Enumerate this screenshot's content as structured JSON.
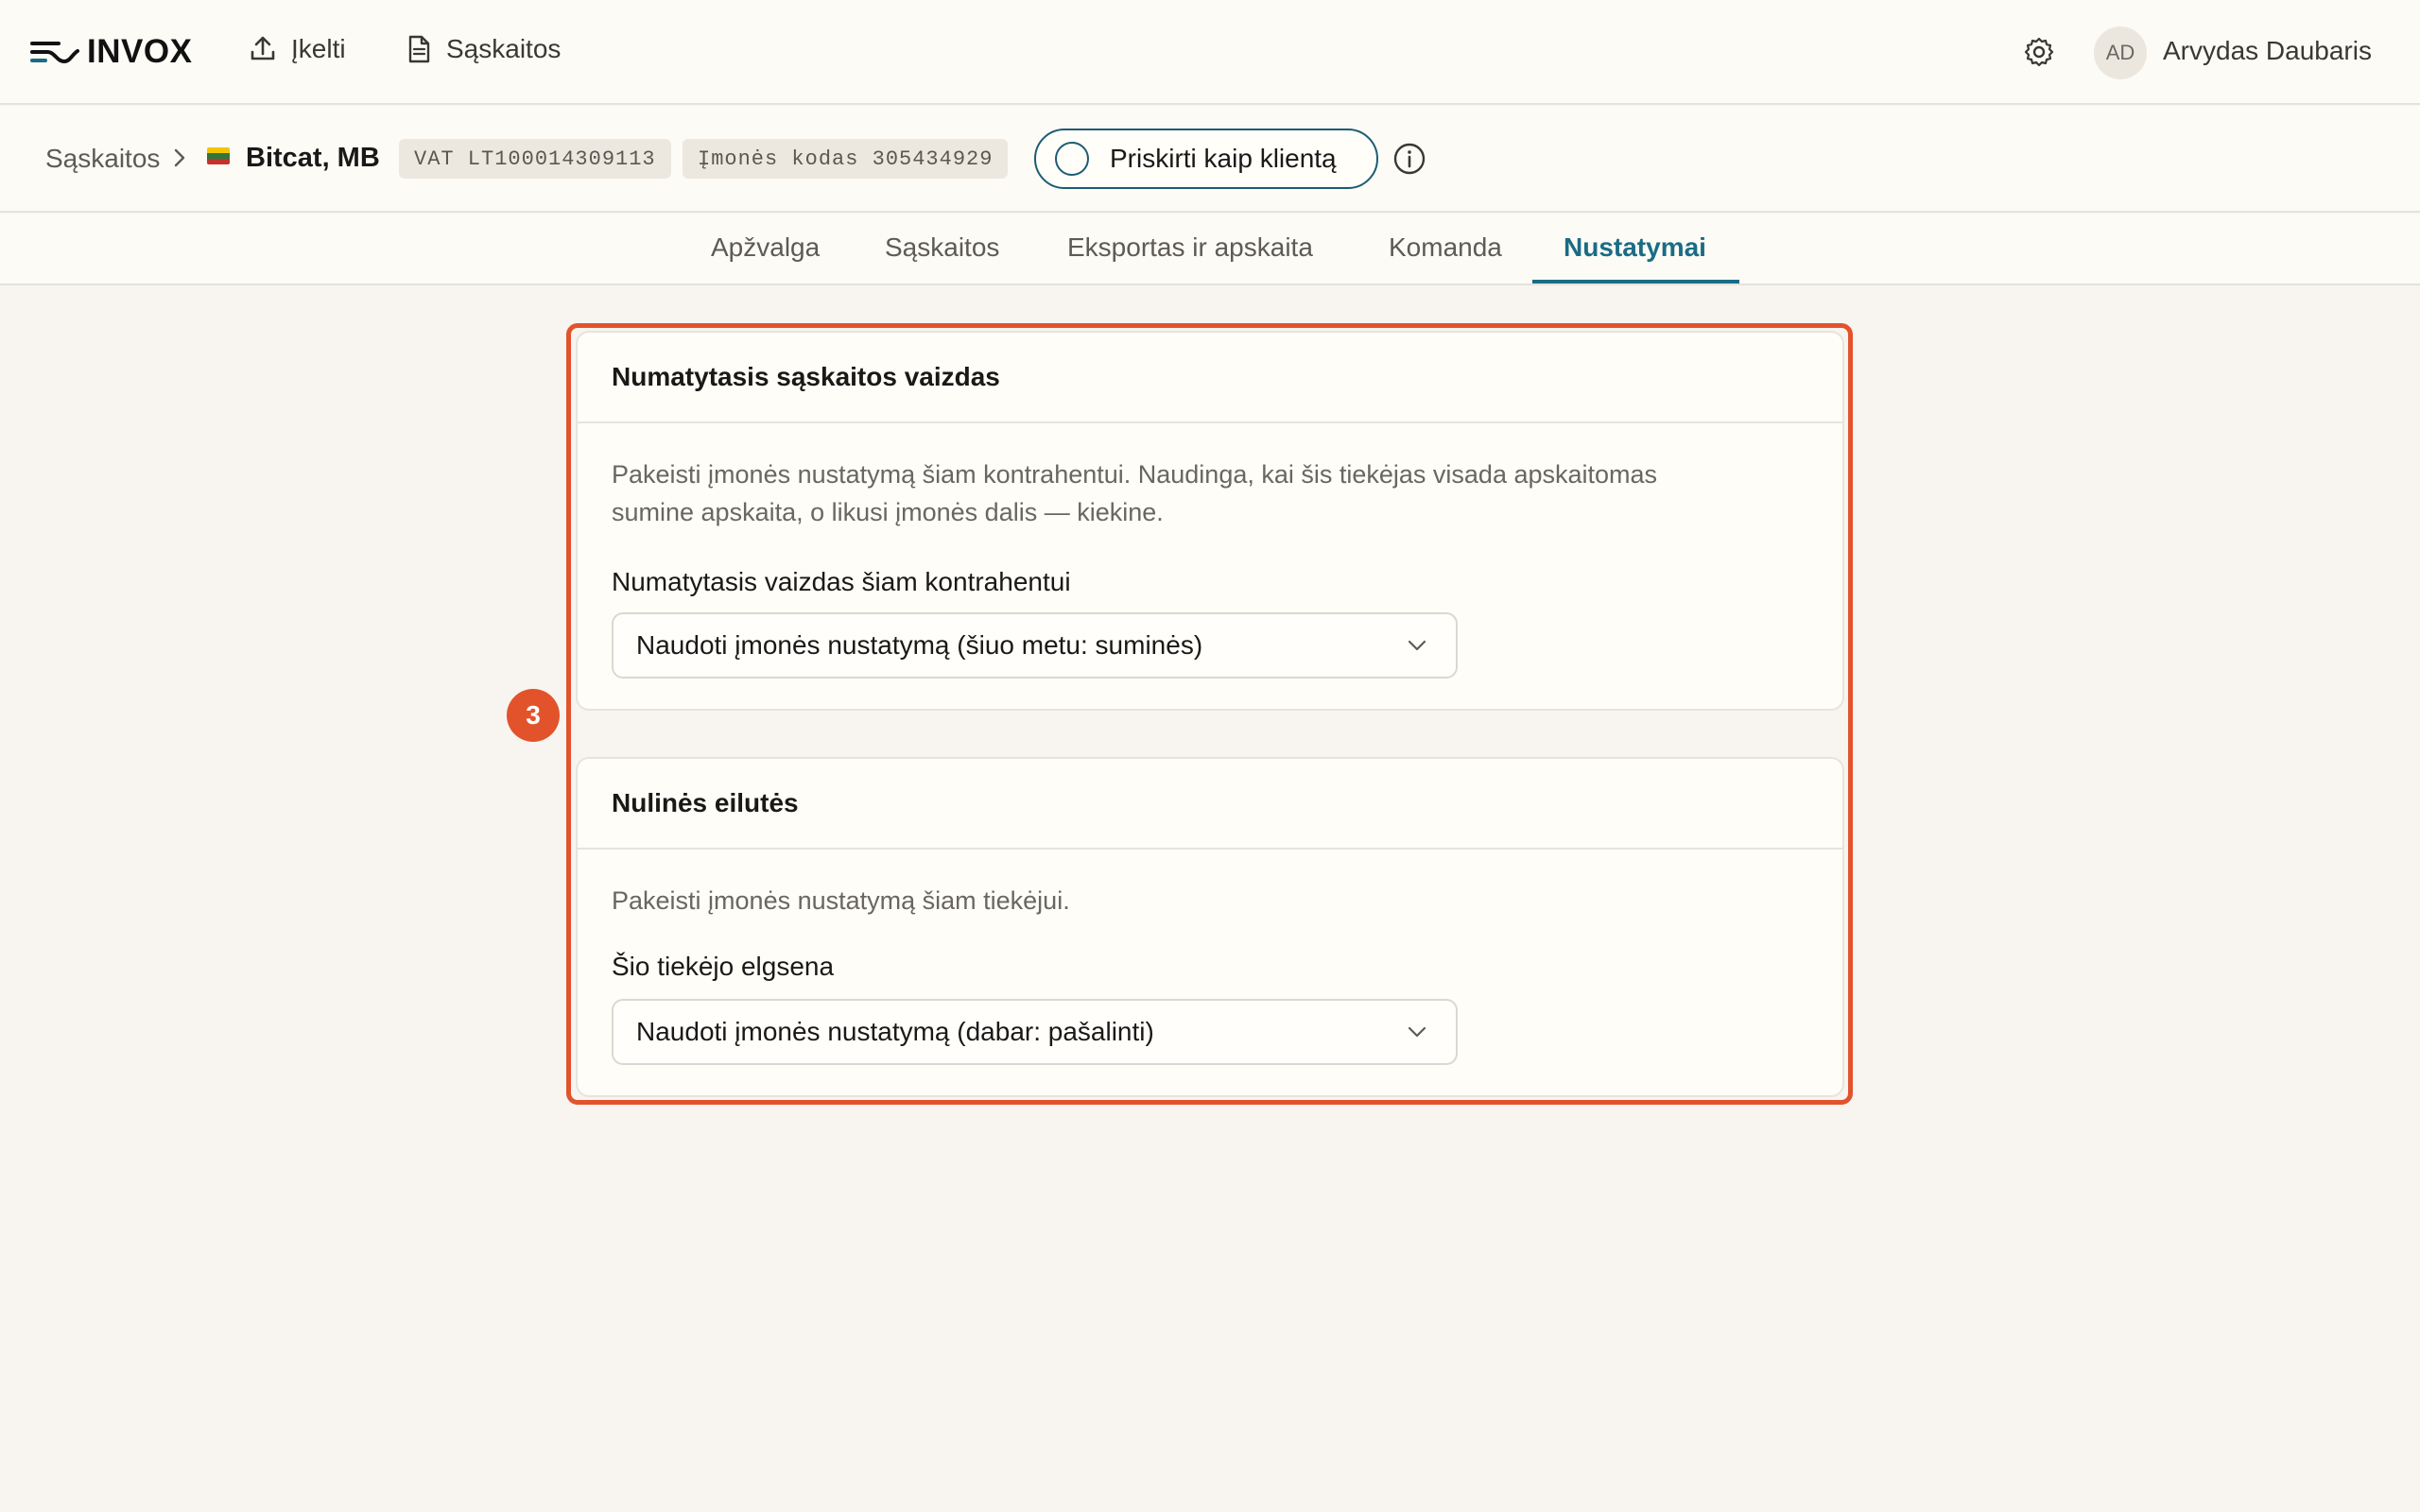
{
  "header": {
    "logo": "INVOX",
    "nav": [
      {
        "label": "Įkelti",
        "icon": "upload-icon"
      },
      {
        "label": "Sąskaitos",
        "icon": "document-icon"
      }
    ],
    "settings_icon": "gear-icon",
    "user": {
      "initials": "AD",
      "name": "Arvydas Daubaris"
    }
  },
  "breadcrumb": {
    "root": "Sąskaitos",
    "separator_icon": "chevron-right-icon",
    "flag": "lithuania-flag",
    "company": "Bitcat, MB",
    "vat": "VAT LT100014309113",
    "company_code": "Įmonės kodas 305434929",
    "assign_button": "Priskirti kaip klientą",
    "info_icon": "info-icon"
  },
  "tabs": [
    {
      "label": "Apžvalga",
      "active": false
    },
    {
      "label": "Sąskaitos",
      "active": false
    },
    {
      "label": "Eksportas ir apskaita",
      "active": false
    },
    {
      "label": "Komanda",
      "active": false
    },
    {
      "label": "Nustatymai",
      "active": true
    }
  ],
  "annotation": {
    "step": "3",
    "color": "#e2532c"
  },
  "cards": {
    "default_view": {
      "title": "Numatytasis sąskaitos vaizdas",
      "description_line1": "Pakeisti įmonės nustatymą šiam kontrahentui. Naudinga, kai šis tiekėjas visada apskaitomas",
      "description_line2": "sumine apskaita, o likusi įmonės dalis — kiekine.",
      "field_label": "Numatytasis vaizdas šiam kontrahentui",
      "select_value": "Naudoti įmonės nustatymą (šiuo metu: suminės)"
    },
    "zero_rows": {
      "title": "Nulinės eilutės",
      "description": "Pakeisti įmonės nustatymą šiam tiekėjui.",
      "field_label": "Šio tiekėjo elgsena",
      "select_value": "Naudoti įmonės nustatymą (dabar: pašalinti)"
    }
  },
  "colors": {
    "accent": "#1a6c84",
    "button_border": "#1d5c74",
    "highlight": "#e2532c"
  }
}
